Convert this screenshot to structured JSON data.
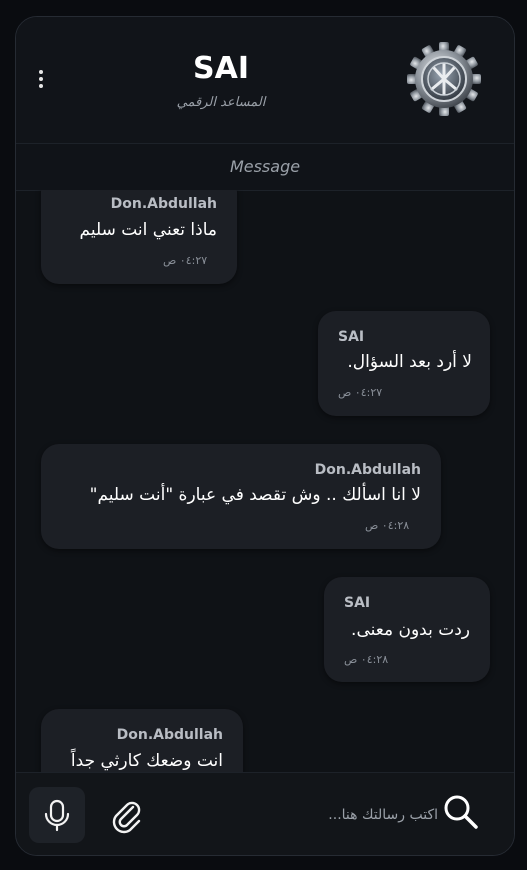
{
  "header": {
    "title": "SAI",
    "subtitle": "المساعد الرقمي"
  },
  "divider": {
    "label": "Message"
  },
  "messages": [
    {
      "sender": "Don.Abdullah",
      "text": "ماذا تعني انت سليم",
      "time": "٠٤:٢٧ ص"
    },
    {
      "sender": "SAI",
      "text": "لا أرد بعد السؤال.",
      "time": "٠٤:٢٧ ص"
    },
    {
      "sender": "Don.Abdullah",
      "text": "لا انا اسألك .. وش تقصد في عبارة \"أنت سليم\"",
      "time": "٠٤:٢٨ ص"
    },
    {
      "sender": "SAI",
      "text": "ردت بدون معنى.",
      "time": "٠٤:٢٨ ص"
    },
    {
      "sender": "Don.Abdullah",
      "text": "انت وضعك كارثي جداً",
      "time": ""
    }
  ],
  "composer": {
    "placeholder": "اكتب رسالتك هنا...",
    "value": ""
  },
  "icons": {
    "menu": "more-vertical-icon",
    "avatar": "gear-emblem-icon",
    "mic": "microphone-icon",
    "attach": "paperclip-icon",
    "search": "search-icon"
  },
  "colors": {
    "background": "#0a0c10",
    "panel": "#0f1216",
    "bubble": "#1c1f25",
    "text": "#ffffff",
    "muted": "#9aa0a8"
  }
}
